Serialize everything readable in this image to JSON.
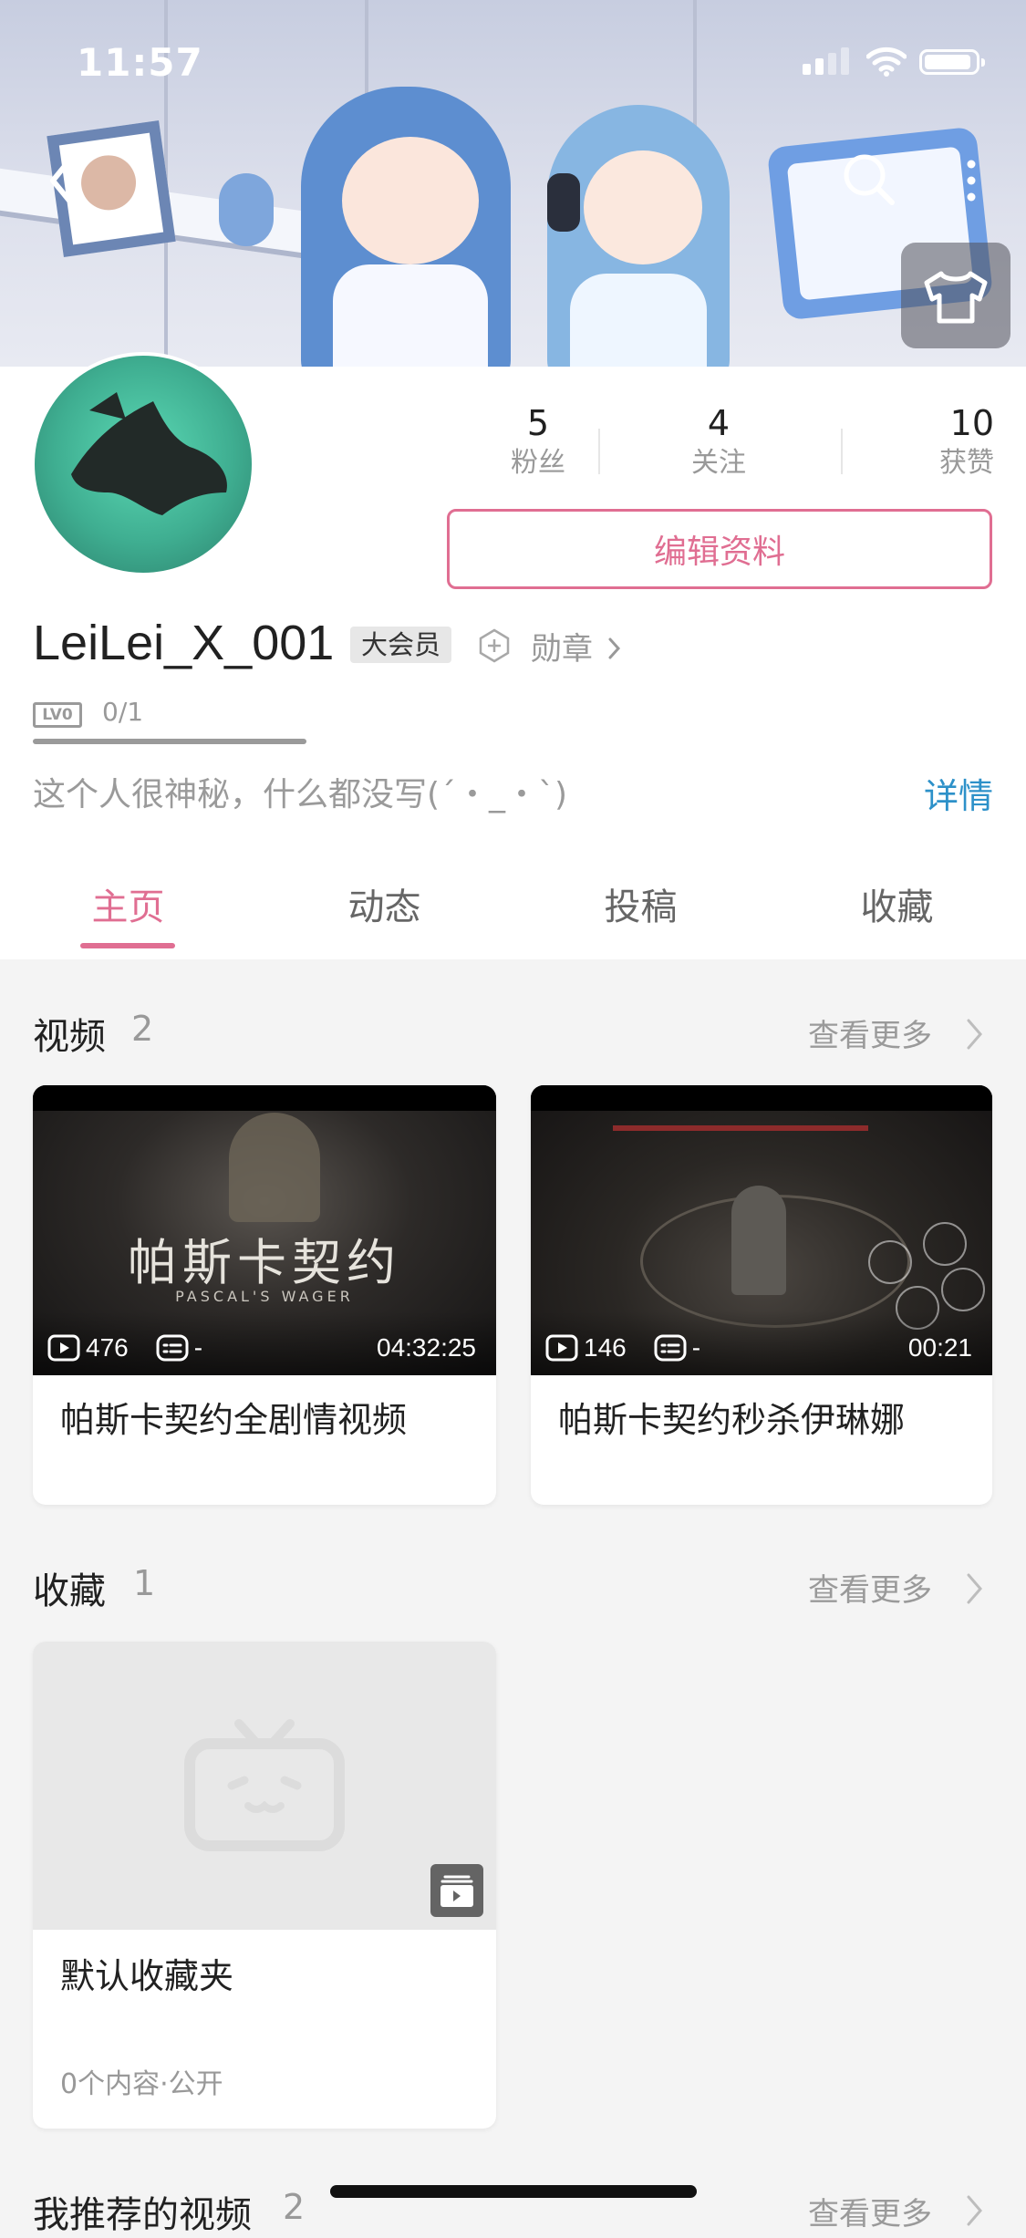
{
  "status_bar": {
    "time": "11:57"
  },
  "profile": {
    "username": "LeiLei_X_001",
    "vip_badge": "大会员",
    "medal_label": "勋章",
    "level_badge": "LV0",
    "level_progress": "0/1",
    "level_progress_fraction": 0,
    "bio": "这个人很神秘，什么都没写(´・_・`)",
    "detail_link": "详情",
    "edit_button": "编辑资料",
    "stats": [
      {
        "value": "5",
        "label": "粉丝"
      },
      {
        "value": "4",
        "label": "关注"
      },
      {
        "value": "10",
        "label": "获赞"
      }
    ]
  },
  "tabs": [
    {
      "label": "主页",
      "active": true
    },
    {
      "label": "动态",
      "active": false
    },
    {
      "label": "投稿",
      "active": false
    },
    {
      "label": "收藏",
      "active": false
    }
  ],
  "videos_section": {
    "title": "视频",
    "count": "2",
    "more": "查看更多",
    "items": [
      {
        "title": "帕斯卡契约全剧情视频",
        "plays": "476",
        "danmaku": "-",
        "duration": "04:32:25",
        "thumb_title": "帕斯卡契约",
        "thumb_subtitle": "PASCAL'S WAGER"
      },
      {
        "title": "帕斯卡契约秒杀伊琳娜",
        "plays": "146",
        "danmaku": "-",
        "duration": "00:21"
      }
    ]
  },
  "favorites_section": {
    "title": "收藏",
    "count": "1",
    "more": "查看更多",
    "items": [
      {
        "title": "默认收藏夹",
        "subtitle": "0个内容·公开"
      }
    ]
  },
  "recommended_section": {
    "title": "我推荐的视频",
    "count": "2",
    "more": "查看更多"
  },
  "colors": {
    "accent_pink": "#e06e92",
    "link_blue": "#2d91c9",
    "background": "#f4f4f4"
  },
  "icons": [
    "back-icon",
    "search-icon",
    "more-icon",
    "dress-up-icon",
    "medal-icon",
    "play-count-icon",
    "danmaku-icon",
    "chevron-right-icon",
    "tv-placeholder-icon",
    "collection-icon"
  ]
}
